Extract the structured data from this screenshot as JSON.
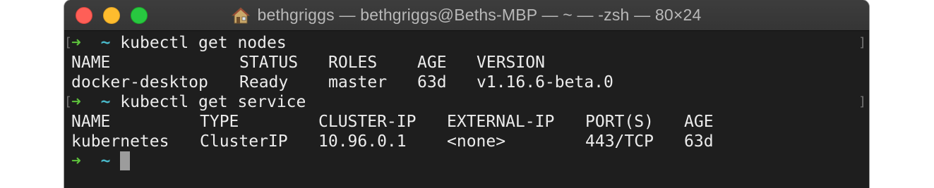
{
  "window": {
    "title": "bethgriggs — bethgriggs@Beths-MBP — ~ — -zsh — 80×24",
    "title_icon": "home-icon"
  },
  "terminal": {
    "prompt_arrow": "➜",
    "prompt_dir": "~",
    "bracket_left": "[",
    "bracket_right": "]",
    "commands": [
      "kubectl get nodes",
      "kubectl get service"
    ],
    "nodes_table": {
      "headers": [
        "NAME",
        "STATUS",
        "ROLES",
        "AGE",
        "VERSION"
      ],
      "rows": [
        [
          "docker-desktop",
          "Ready",
          "master",
          "63d",
          "v1.16.6-beta.0"
        ]
      ]
    },
    "service_table": {
      "headers": [
        "NAME",
        "TYPE",
        "CLUSTER-IP",
        "EXTERNAL-IP",
        "PORT(S)",
        "AGE"
      ],
      "rows": [
        [
          "kubernetes",
          "ClusterIP",
          "10.96.0.1",
          "<none>",
          "443/TCP",
          "63d"
        ]
      ]
    }
  },
  "colors": {
    "background": "#1e1e1e",
    "prompt_arrow": "#5ec33c",
    "prompt_dir": "#49b8c9",
    "text": "#ececec"
  }
}
